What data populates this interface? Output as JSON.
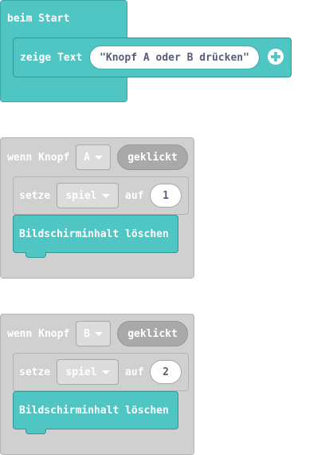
{
  "blocks": {
    "start": {
      "header": "beim Start",
      "show_text_label": "zeige Text",
      "text_value": "\"Knopf A oder B drücken\"",
      "plus_icon": "plus-circle-icon"
    },
    "button_a": {
      "header": "wenn Knopf",
      "button": "A",
      "event": "geklickt",
      "set_label": "setze",
      "variable": "spiel",
      "to_label": "auf",
      "value": "1",
      "clear_label": "Bildschirminhalt löschen"
    },
    "button_b": {
      "header": "wenn Knopf",
      "button": "B",
      "event": "geklickt",
      "set_label": "setze",
      "variable": "spiel",
      "to_label": "auf",
      "value": "2",
      "clear_label": "Bildschirminhalt löschen"
    }
  },
  "colors": {
    "basic_block": "#4fc6c4",
    "event_block": "#d0d0d0",
    "field_text": "#575e75"
  }
}
